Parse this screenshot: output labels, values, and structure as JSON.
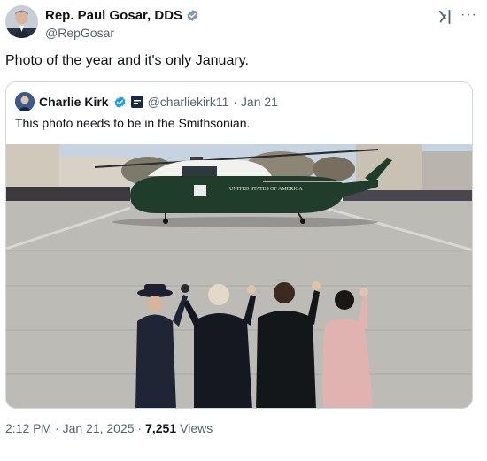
{
  "post": {
    "author": {
      "name": "Rep. Paul Gosar, DDS",
      "handle": "@RepGosar",
      "verified_color": "#829aab"
    },
    "text": "Photo of the year and it's only January.",
    "icons": {
      "grok": "grok-icon",
      "more": "more-icon",
      "more_glyph": "···"
    },
    "timestamp": "2:12 PM · Jan 21, 2025 ·",
    "views_count": "7,251",
    "views_label": "Views"
  },
  "quoted_post": {
    "author": {
      "name": "Charlie Kirk",
      "handle": "@charliekirk11",
      "date": "· Jan 21",
      "verified_color": "#1d9bf0"
    },
    "text": "This photo needs to be in the Smithsonian.",
    "image": {
      "helicopter_text": "UNITED STATES OF AMERICA"
    }
  }
}
